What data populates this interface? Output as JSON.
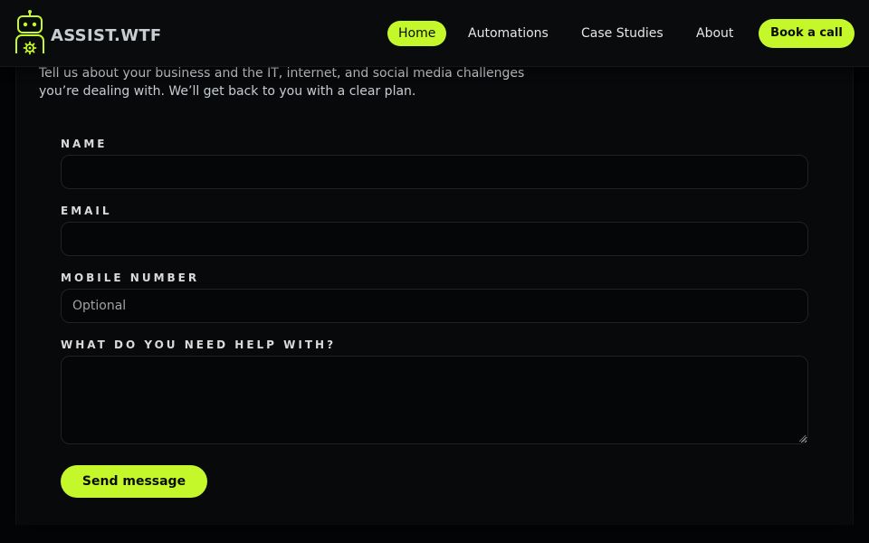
{
  "brand": {
    "name": "ASSIST.WTF",
    "logo_icon": "robot-gear-icon",
    "accent_color": "#c5f82a"
  },
  "nav": {
    "items": [
      {
        "label": "Home",
        "active": true
      },
      {
        "label": "Automations",
        "active": false
      },
      {
        "label": "Case Studies",
        "active": false
      },
      {
        "label": "About",
        "active": false
      }
    ],
    "cta_label": "Book a call"
  },
  "intro": {
    "text": "Tell us about your business and the IT, internet, and social media challenges you’re dealing with. We’ll get back to you with a clear plan."
  },
  "form": {
    "name": {
      "label": "NAME",
      "value": "",
      "placeholder": ""
    },
    "email": {
      "label": "EMAIL",
      "value": "",
      "placeholder": ""
    },
    "mobile": {
      "label": "MOBILE NUMBER",
      "value": "",
      "placeholder": "Optional"
    },
    "help": {
      "label": "WHAT DO YOU NEED HELP WITH?",
      "value": "",
      "placeholder": ""
    },
    "submit_label": "Send message"
  }
}
